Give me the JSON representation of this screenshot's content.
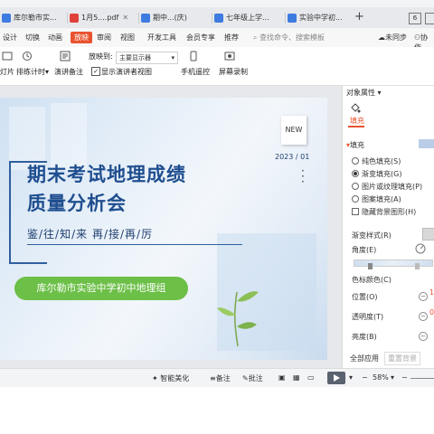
{
  "tabs": [
    {
      "label": "库尔勒市实..."
    },
    {
      "label": "1月5....pdf"
    },
    {
      "label": "期中...(庆)"
    },
    {
      "label": "七年级上学..."
    },
    {
      "label": "实验中学初..."
    }
  ],
  "window": {
    "counter": "6"
  },
  "menu": {
    "items": [
      "设计",
      "切换",
      "动画",
      "放映",
      "审阅",
      "视图",
      "开发工具",
      "会员专享",
      "推荐"
    ],
    "active": "放映",
    "search_placeholder": "查找命令、搜索模板",
    "sync": "未同步",
    "collab": "协作"
  },
  "ribbon": {
    "lights_label": "灯片",
    "rehearse_label": "排练计时",
    "notes_label": "演讲备注",
    "display_label": "放映到:",
    "display_value": "主要显示器",
    "presenter_view_label": "显示演讲者视图",
    "presenter_view_checked": "✓",
    "remote_label": "手机遥控",
    "record_label": "屏幕录制"
  },
  "slide": {
    "title_line1": "期末考试地理成绩",
    "title_line2": "质量分析会",
    "subtitle": "鉴/往/知/来  再/接/再/厉",
    "badge": "库尔勒市实验中学初中地理组",
    "new_badge": "NEW",
    "date": "2023 / 01"
  },
  "pane": {
    "header": "对象属性",
    "fill_tab": "填充",
    "fill_section": "填充",
    "options": [
      {
        "label": "纯色填充(S)",
        "selected": false
      },
      {
        "label": "渐变填充(G)",
        "selected": true
      },
      {
        "label": "图片或纹理填充(P)",
        "selected": false
      },
      {
        "label": "图案填充(A)",
        "selected": false
      }
    ],
    "hide_bg_label": "隐藏背景图形(H)",
    "gradient_style_label": "渐变样式(R)",
    "angle_label": "角度(E)",
    "color_label": "色标颜色(C)",
    "position_label": "位置(O)",
    "position_value": "1",
    "transparency_label": "透明度(T)",
    "transparency_value": "0",
    "brightness_label": "亮度(B)",
    "apply_all": "全部应用",
    "reset_bg": "重置背景",
    "accent": "#e9532f"
  },
  "status": {
    "beautify": "智能美化",
    "notes": "备注",
    "comments": "批注",
    "zoom": "58%"
  }
}
